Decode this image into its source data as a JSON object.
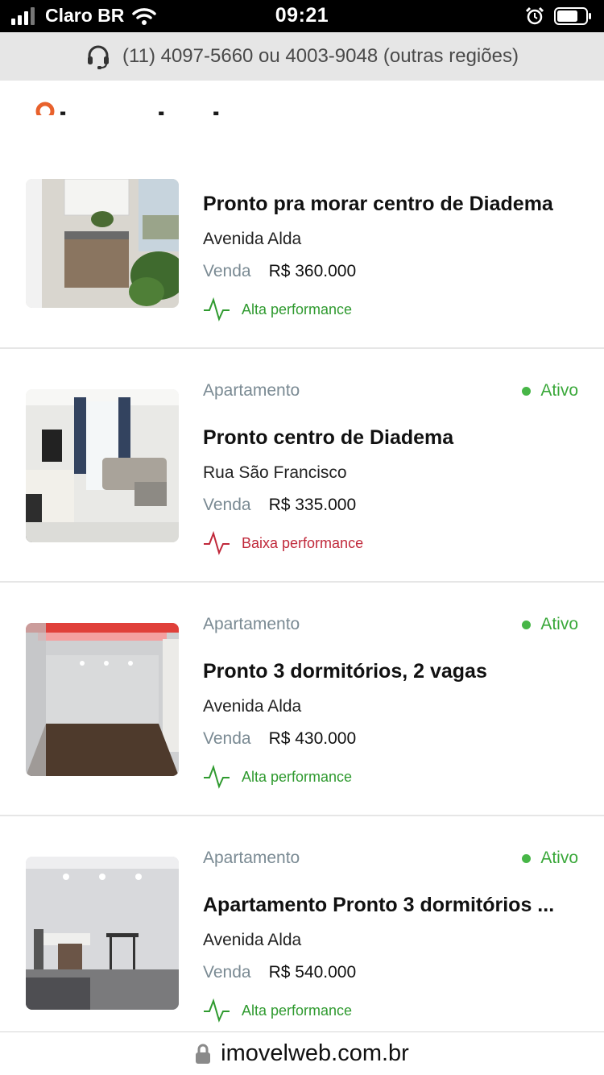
{
  "status_bar": {
    "carrier": "Claro BR",
    "time": "09:21",
    "icons": [
      "signal-icon",
      "wifi-icon",
      "alarm-icon",
      "battery-icon"
    ]
  },
  "contact": {
    "phone_text": "(11) 4097-5660 ou 4003-9048 (outras regiões)",
    "icon": "headset-icon"
  },
  "header": {
    "logo_text": "imovelweb",
    "menu_icon": "hamburger-menu-icon"
  },
  "listings": [
    {
      "type": "",
      "status": "",
      "title": "Pronto pra morar centro de Diadema",
      "address": "Avenida Alda",
      "operation": "Venda",
      "price": "R$ 360.000",
      "performance": "Alta performance",
      "performance_level": "high"
    },
    {
      "type": "Apartamento",
      "status": "Ativo",
      "title": "Pronto centro de Diadema",
      "address": "Rua São Francisco",
      "operation": "Venda",
      "price": "R$ 335.000",
      "performance": "Baixa performance",
      "performance_level": "low"
    },
    {
      "type": "Apartamento",
      "status": "Ativo",
      "title": "Pronto 3 dormitórios, 2 vagas",
      "address": "Avenida Alda",
      "operation": "Venda",
      "price": "R$ 430.000",
      "performance": "Alta performance",
      "performance_level": "high"
    },
    {
      "type": "Apartamento",
      "status": "Ativo",
      "title": "Apartamento Pronto 3 dormitórios ...",
      "address": "Avenida Alda",
      "operation": "Venda",
      "price": "R$ 540.000",
      "performance": "Alta performance",
      "performance_level": "high"
    }
  ],
  "browser": {
    "url": "imovelweb.com.br",
    "icon": "lock-icon"
  },
  "colors": {
    "brand_orange": "#e8612c",
    "status_green": "#47b647",
    "perf_high": "#2f9a2f",
    "perf_low": "#c0283a",
    "muted_text": "#7a8a93"
  }
}
